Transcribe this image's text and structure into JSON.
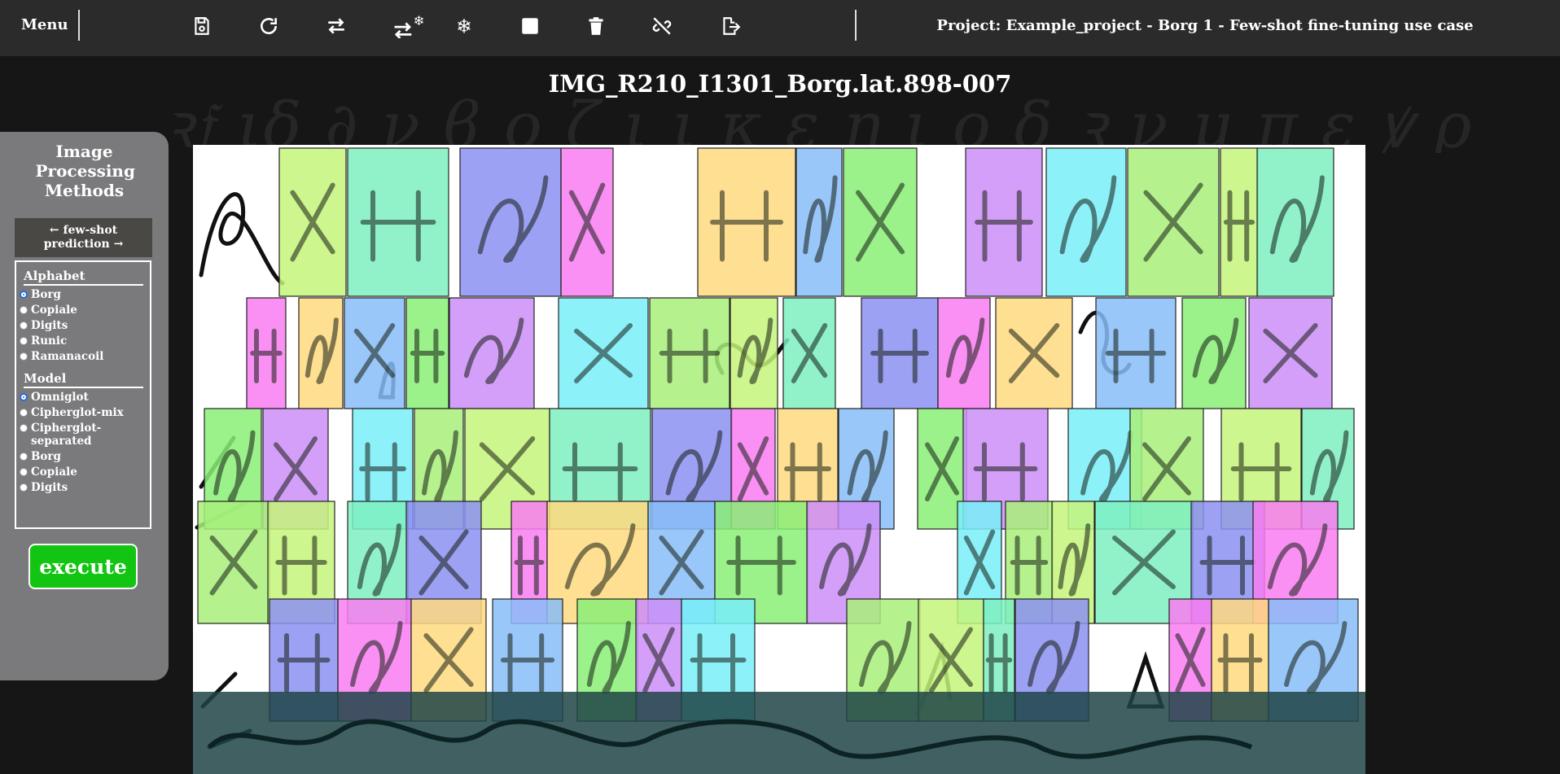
{
  "header": {
    "menu_label": "Menu",
    "project_title": "Project: Example_project - Borg 1 - Few-shot fine-tuning use case",
    "tools": [
      {
        "name": "save-icon"
      },
      {
        "name": "redo-icon"
      },
      {
        "name": "transfer-icon"
      },
      {
        "name": "transfer-freeze-icon"
      },
      {
        "name": "snowflake-icon"
      },
      {
        "name": "square-icon"
      },
      {
        "name": "trash-icon"
      },
      {
        "name": "unlink-icon"
      },
      {
        "name": "export-icon"
      }
    ]
  },
  "document": {
    "title": "IMG_R210_I1301_Borg.lat.898-007"
  },
  "panel": {
    "title": "Image Processing Methods",
    "few_shot_label": "← few-shot prediction →",
    "alphabet_label": "Alphabet",
    "alphabet_options": [
      "Borg",
      "Copiale",
      "Digits",
      "Runic",
      "Ramanacoil"
    ],
    "alphabet_selected": "Borg",
    "model_label": "Model",
    "model_options": [
      "Omniglot",
      "Cipherglot-mix",
      "Cipherglot-separated",
      "Borg",
      "Copiale",
      "Digits"
    ],
    "model_selected": "Omniglot",
    "execute_label": "execute"
  },
  "colors": {
    "topbar": "#2b2b2b",
    "background": "#161616",
    "panel": "#7a7a7c",
    "execute": "#12c512",
    "box_palette": [
      "#c6f57a",
      "#7ef0c0",
      "#8c90f2",
      "#f97df2",
      "#ffd97f",
      "#88bdf8",
      "#89ef76",
      "#cd8ef8",
      "#78eef8",
      "#a8f07a"
    ]
  }
}
